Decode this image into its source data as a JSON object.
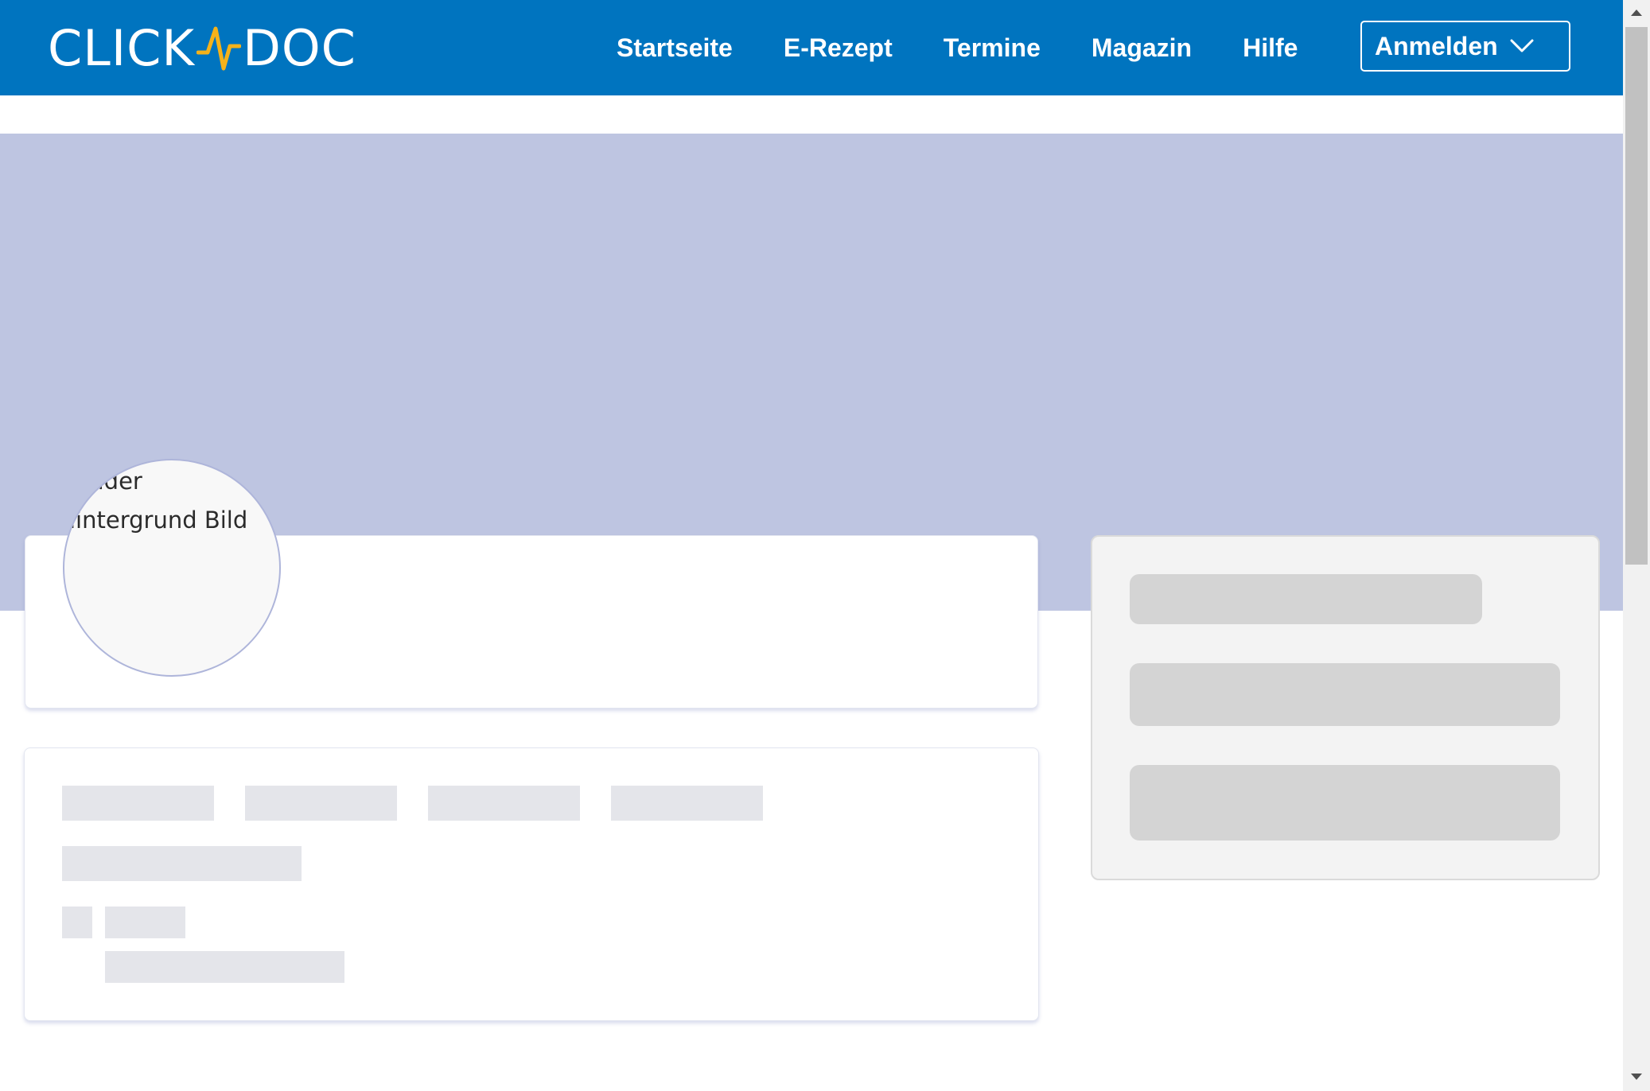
{
  "header": {
    "logo_left": "CLICK",
    "logo_right": "DOC",
    "nav": [
      {
        "label": "Startseite"
      },
      {
        "label": "E-Rezept"
      },
      {
        "label": "Termine"
      },
      {
        "label": "Magazin"
      },
      {
        "label": "Hilfe"
      }
    ],
    "login_label": "Anmelden",
    "login_icon": "chevron-down-icon"
  },
  "profile": {
    "avatar_alt_line1": "ieader",
    "avatar_alt_line2": "iintergrund Bild"
  },
  "colors": {
    "brand_blue": "#0074bf",
    "logo_accent": "#f5b21a",
    "hero_background": "#bec5e1",
    "skeleton": "#e4e5ea",
    "side_skeleton": "#d4d4d4"
  }
}
